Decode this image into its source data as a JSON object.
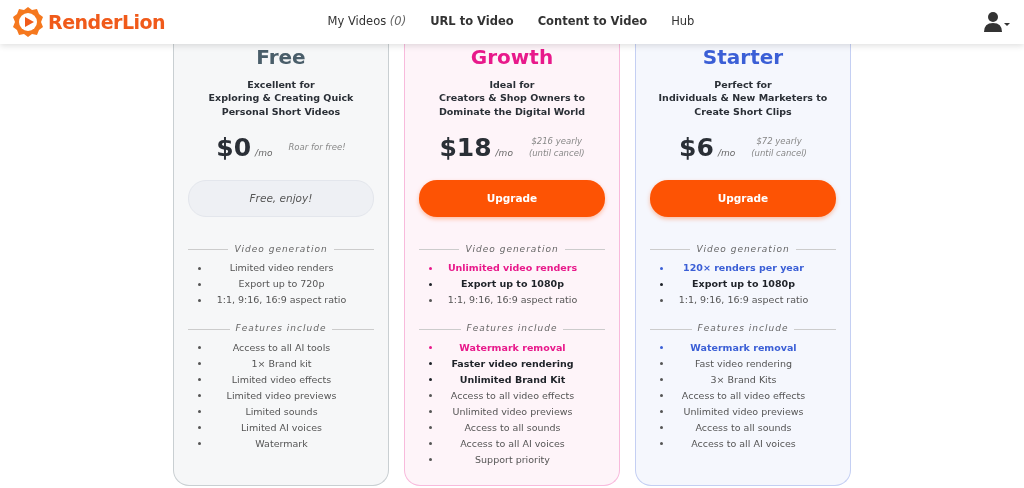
{
  "navbar": {
    "logo": "RenderLion",
    "links": [
      {
        "label": "My Videos",
        "count": "(0)",
        "kind": "plain"
      },
      {
        "label": "URL to Video",
        "kind": "bold"
      },
      {
        "label": "Content to Video",
        "kind": "bold"
      },
      {
        "label": "Hub",
        "kind": "plain"
      }
    ]
  },
  "plans": [
    {
      "name": "Free",
      "color": "#4a5e6a",
      "tagline": "Excellent for",
      "description": "Exploring & Creating Quick Personal Short Videos",
      "price": "$0",
      "period": "/mo",
      "note": "Roar for free!",
      "button": {
        "label": "Free, enjoy!",
        "kind": "free"
      },
      "sections": [
        {
          "title": "Video generation",
          "items": [
            {
              "text": "Limited video renders",
              "kind": "plain"
            },
            {
              "text": "Export up to 720p",
              "kind": "plain"
            },
            {
              "text": "1:1, 9:16, 16:9 aspect ratio",
              "kind": "plain"
            }
          ]
        },
        {
          "title": "Features include",
          "items": [
            {
              "text": "Access to all AI tools",
              "kind": "plain"
            },
            {
              "text": "1× Brand kit",
              "kind": "plain"
            },
            {
              "text": "Limited video effects",
              "kind": "plain"
            },
            {
              "text": "Limited video previews",
              "kind": "plain"
            },
            {
              "text": "Limited sounds",
              "kind": "plain"
            },
            {
              "text": "Limited AI voices",
              "kind": "plain"
            },
            {
              "text": "Watermark",
              "kind": "plain"
            }
          ]
        }
      ]
    },
    {
      "name": "Growth",
      "color": "#e8198b",
      "tagline": "Ideal for",
      "description": "Creators & Shop Owners to Dominate the Digital World",
      "price": "$18",
      "period": "/mo",
      "note": "$216 yearly",
      "note_2": "(until cancel)",
      "button": {
        "label": "Upgrade",
        "kind": "upgrade"
      },
      "sections": [
        {
          "title": "Video generation",
          "items": [
            {
              "text": "Unlimited video renders",
              "kind": "highlight"
            },
            {
              "text": "Export up to 1080p",
              "kind": "bold"
            },
            {
              "text": "1:1, 9:16, 16:9 aspect ratio",
              "kind": "plain"
            }
          ]
        },
        {
          "title": "Features include",
          "items": [
            {
              "text": "Watermark removal",
              "kind": "highlight"
            },
            {
              "text": "Faster video rendering",
              "kind": "bold"
            },
            {
              "text": "Unlimited Brand Kit",
              "kind": "bold"
            },
            {
              "text": "Access to all video effects",
              "kind": "plain"
            },
            {
              "text": "Unlimited video previews",
              "kind": "plain"
            },
            {
              "text": "Access to all sounds",
              "kind": "plain"
            },
            {
              "text": "Access to all AI voices",
              "kind": "plain"
            },
            {
              "text": "Support priority",
              "kind": "plain"
            }
          ]
        }
      ]
    },
    {
      "name": "Starter",
      "color": "#3b5fd6",
      "tagline": "Perfect for",
      "description": "Individuals & New Marketers to Create Short Clips",
      "price": "$6",
      "period": "/mo",
      "note": "$72 yearly",
      "note_2": "(until cancel)",
      "button": {
        "label": "Upgrade",
        "kind": "upgrade"
      },
      "sections": [
        {
          "title": "Video generation",
          "items": [
            {
              "text": "120× renders per year",
              "kind": "highlight"
            },
            {
              "text": "Export up to 1080p",
              "kind": "bold"
            },
            {
              "text": "1:1, 9:16, 16:9 aspect ratio",
              "kind": "plain"
            }
          ]
        },
        {
          "title": "Features include",
          "items": [
            {
              "text": "Watermark removal",
              "kind": "highlight"
            },
            {
              "text": "Fast video rendering",
              "kind": "plain"
            },
            {
              "text": "3× Brand Kits",
              "kind": "plain"
            },
            {
              "text": "Access to all video effects",
              "kind": "plain"
            },
            {
              "text": "Unlimited video previews",
              "kind": "plain"
            },
            {
              "text": "Access to all sounds",
              "kind": "plain"
            },
            {
              "text": "Access to all AI voices",
              "kind": "plain"
            }
          ]
        }
      ]
    }
  ]
}
